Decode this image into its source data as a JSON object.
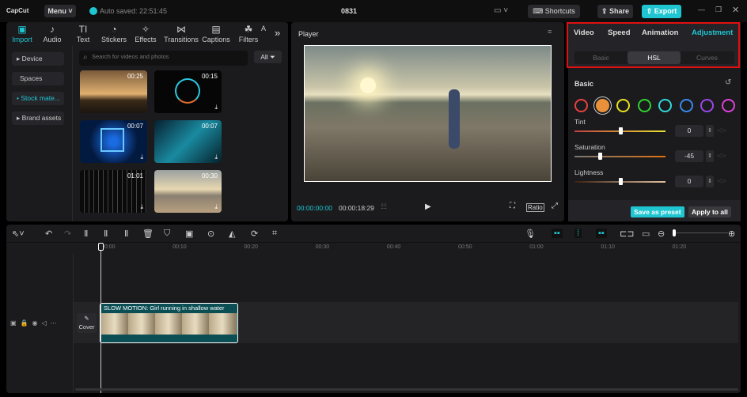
{
  "app": {
    "logo": "CapCut",
    "menu": "Menu",
    "autosave": "Auto saved: 22:51:45",
    "project": "0831",
    "shortcuts": "Shortcuts",
    "share": "Share",
    "export": "Export"
  },
  "media_tabs": [
    {
      "label": "Import",
      "icon": "▣"
    },
    {
      "label": "Audio",
      "icon": "♪"
    },
    {
      "label": "Text",
      "icon": "TI"
    },
    {
      "label": "Stickers",
      "icon": "◔"
    },
    {
      "label": "Effects",
      "icon": "✧"
    },
    {
      "label": "Transitions",
      "icon": "⋈"
    },
    {
      "label": "Captions",
      "icon": "▤"
    },
    {
      "label": "Filters",
      "icon": "☘"
    },
    {
      "label": "A",
      "icon": ""
    }
  ],
  "sidebar": [
    "▸ Device",
    "Spaces",
    "• Stock mate...",
    "▸ Brand assets"
  ],
  "search": {
    "placeholder": "Search for videos and photos",
    "filter": "All"
  },
  "thumbs": [
    {
      "duration": "00:25"
    },
    {
      "duration": "00:15"
    },
    {
      "duration": "00:07"
    },
    {
      "duration": "00:07"
    },
    {
      "duration": "01:01"
    },
    {
      "duration": "00:30"
    }
  ],
  "player": {
    "title": "Player",
    "current": "00:00:00:00",
    "total": "00:00:18:29",
    "ratio": "Ratio"
  },
  "right": {
    "tabs": [
      "Video",
      "Speed",
      "Animation",
      "Adjustment"
    ],
    "subtabs": [
      "Basic",
      "HSL",
      "Curves"
    ],
    "section": "Basic",
    "colors": [
      "#e84040",
      "#e8913a",
      "#e8e020",
      "#30d030",
      "#30d8d8",
      "#3a88e8",
      "#9a48e8",
      "#e040d8"
    ],
    "sliders": [
      {
        "label": "Tint",
        "value": "0",
        "fraction": 0.5
      },
      {
        "label": "Saturation",
        "value": "-45",
        "fraction": 0.275
      },
      {
        "label": "Lightness",
        "value": "0",
        "fraction": 0.5
      }
    ],
    "save_preset": "Save as preset",
    "apply_all": "Apply to all"
  },
  "timeline": {
    "ticks": [
      "00:00",
      "00:10",
      "00:20",
      "00:30",
      "00:40",
      "00:50",
      "01:00",
      "01:10",
      "01:20"
    ],
    "clip": "SLOW MOTION: Girl running in shallow water",
    "cover": "Cover"
  }
}
